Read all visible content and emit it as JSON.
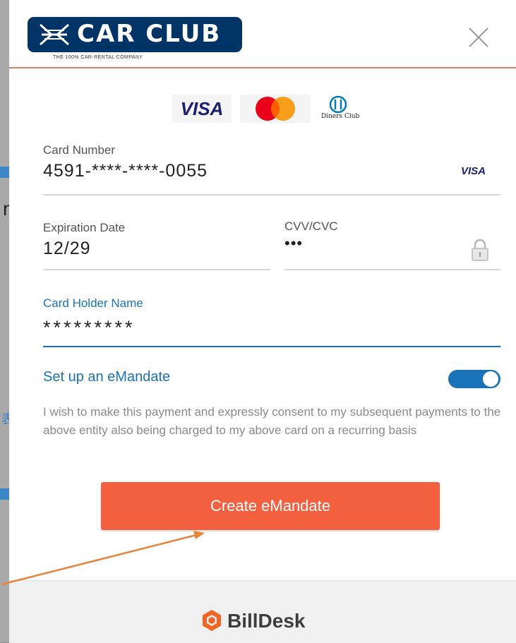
{
  "background": {
    "glyph_letter": "n"
  },
  "header": {
    "logo_text": "CAR CLUB",
    "logo_tagline": "THE 100% CAR-RENTAL COMPANY",
    "close_icon": "close-icon"
  },
  "card_brands": {
    "visa": "VISA",
    "mastercard_icon": "mastercard-logo-icon",
    "diners": "Diners Club"
  },
  "form": {
    "card_number": {
      "label": "Card Number",
      "value": "4591-****-****-0055",
      "brand": "VISA"
    },
    "expiration": {
      "label": "Expiration Date",
      "value": "12/29"
    },
    "cvv": {
      "label": "CVV/CVC",
      "value": "•••",
      "icon": "lock-icon"
    },
    "card_holder": {
      "label": "Card Holder Name",
      "value": "*********"
    }
  },
  "emandate": {
    "label": "Set up an eMandate",
    "enabled": true,
    "consent": "I wish to make this payment and expressly consent to my subsequent payments to the above entity also being charged to my above card on a recurring basis",
    "button": "Create eMandate"
  },
  "footer": {
    "brand": "BillDesk",
    "icon": "billdesk-logo-icon"
  },
  "colors": {
    "accent_blue": "#1a73b8",
    "cta_orange": "#f2603f",
    "logo_navy": "#003366",
    "header_rule": "#d8826a",
    "annotation_arrow": "#e8843a"
  }
}
